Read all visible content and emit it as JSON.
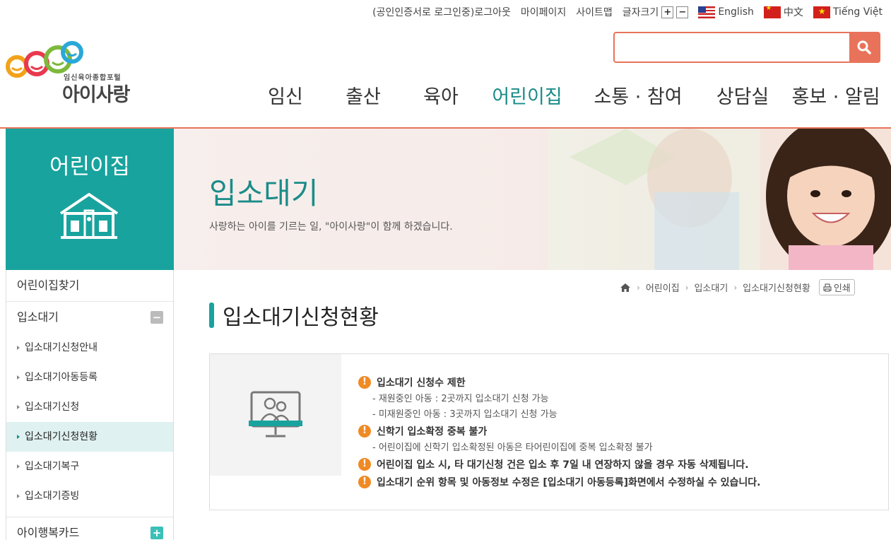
{
  "util": {
    "logout": "(공인인증서로 로그인중)로그아웃",
    "mypage": "마이페이지",
    "sitemap": "사이트맵",
    "font_size": "글자크기",
    "font_plus": "+",
    "font_minus": "−",
    "lang_en": "English",
    "lang_cn": "中文",
    "lang_vn": "Tiếng Việt"
  },
  "logo": {
    "sub": "임신육아종합포털",
    "main": "아이사랑"
  },
  "search": {
    "value": "",
    "placeholder": ""
  },
  "gnb": [
    "임신",
    "출산",
    "육아",
    "어린이집",
    "소통 · 참여",
    "상담실",
    "홍보 · 알림"
  ],
  "sidebox": {
    "title": "어린이집"
  },
  "banner": {
    "title": "입소대기",
    "subtitle": "사랑하는 아이를 기르는 일, \"아이사랑\"이 함께 하겠습니다."
  },
  "lnb": {
    "item1": "어린이집찾기",
    "item2": "입소대기",
    "toggle_minus": "−",
    "sub": [
      "입소대기신청안내",
      "입소대기아동등록",
      "입소대기신청",
      "입소대기신청현황",
      "입소대기복구",
      "입소대기증빙"
    ],
    "item3": "아이행복카드",
    "toggle_plus": "+"
  },
  "breadcrumb": {
    "c1": "어린이집",
    "c2": "입소대기",
    "c3": "입소대기신청현황",
    "print": "인쇄"
  },
  "page_title": "입소대기신청현황",
  "info": {
    "h1": "입소대기 신청수 제한",
    "h1_sub1": "- 재원중인 아동 : 2곳까지 입소대기 신청 가능",
    "h1_sub2": "- 미재원중인 아동 : 3곳까지 입소대기 신청 가능",
    "h2": "신학기 입소확정 중복 불가",
    "h2_sub1": "- 어린이집에 신학기 입소확정된 아동은 타어린이집에 중복 입소확정 불가",
    "h3": "어린이집 입소 시, 타 대기신청 건은 입소 후 7일 내 연장하지 않을 경우 자동 삭제됩니다.",
    "h4": "입소대기 순위 항목 및 아동정보 수정은 [입소대기 아동등록]화면에서 수정하실 수 있습니다.",
    "mark": "!"
  },
  "colors": {
    "accent": "#19a39e",
    "brand_orange": "#e8735a",
    "warn": "#f08a24"
  }
}
